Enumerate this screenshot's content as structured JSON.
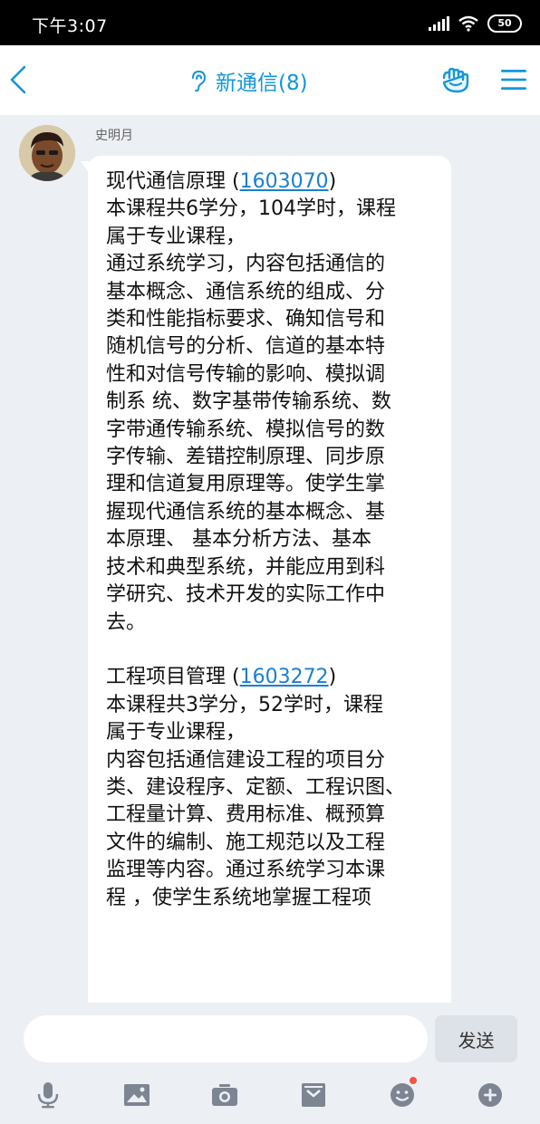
{
  "status_bar": {
    "time": "下午3:07",
    "battery": "50"
  },
  "nav": {
    "title": "新通信(8)",
    "accent_color": "#1296db"
  },
  "chat": {
    "sender_name": "史明月",
    "message_lines": [
      {
        "before": "现代通信原理 (",
        "link": "1603070",
        "after": ")"
      },
      {
        "text": "本课程共6学分，104学时，课程"
      },
      {
        "text": "属于专业课程，"
      },
      {
        "text": "通过系统学习，内容包括通信的"
      },
      {
        "text": "基本概念、通信系统的组成、分"
      },
      {
        "text": "类和性能指标要求、确知信号和"
      },
      {
        "text": "随机信号的分析、信道的基本特"
      },
      {
        "text": "性和对信号传输的影响、模拟调"
      },
      {
        "text": "制系 统、数字基带传输系统、数"
      },
      {
        "text": "字带通传输系统、模拟信号的数"
      },
      {
        "text": "字传输、差错控制原理、同步原"
      },
      {
        "text": "理和信道复用原理等。使学生掌"
      },
      {
        "text": "握现代通信系统的基本概念、基"
      },
      {
        "text": "本原理、 基本分析方法、基本"
      },
      {
        "text": "技术和典型系统，并能应用到科"
      },
      {
        "text": "学研究、技术开发的实际工作中"
      },
      {
        "text": "去。"
      },
      {
        "text": ""
      },
      {
        "before": "工程项目管理 (",
        "link": "1603272",
        "after": ")"
      },
      {
        "text": "本课程共3学分，52学时，课程"
      },
      {
        "text": "属于专业课程，"
      },
      {
        "text": "内容包括通信建设工程的项目分"
      },
      {
        "text": "类、建设程序、定额、工程识图、"
      },
      {
        "text": "工程量计算、费用标准、概预算"
      },
      {
        "text": "文件的编制、施工规范以及工程"
      },
      {
        "text": "监理等内容。通过系统学习本课"
      },
      {
        "text": "程 ，使学生系统地掌握工程项"
      }
    ]
  },
  "input": {
    "value": "",
    "send_label": "发送"
  },
  "toolbar_icons": [
    "microphone-icon",
    "image-icon",
    "camera-icon",
    "file-icon",
    "emoji-icon",
    "plus-icon"
  ]
}
